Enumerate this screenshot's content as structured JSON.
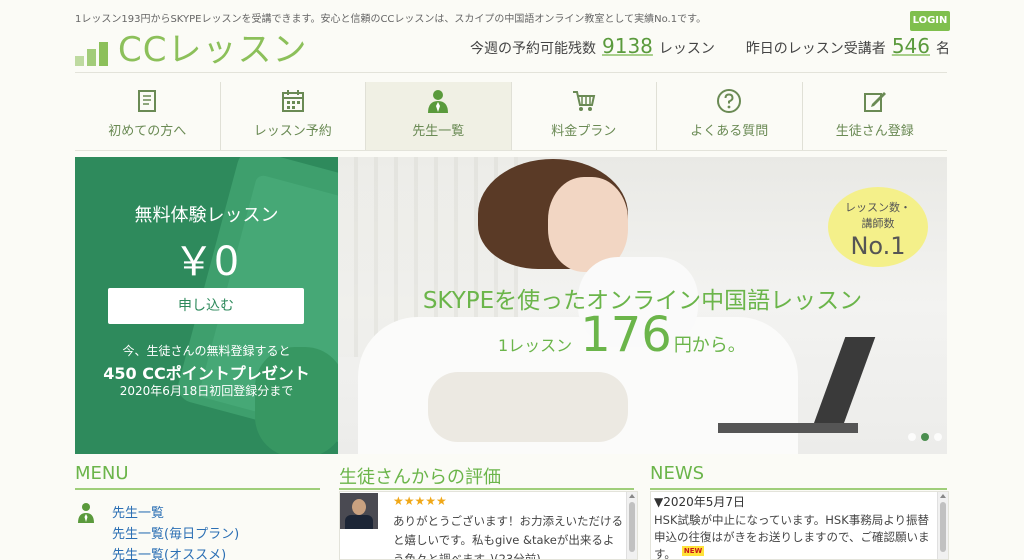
{
  "header": {
    "tagline": "1レッスン193円からSKYPEレッスンを受講できます。安心と信頼のCCレッスンは、スカイプの中国語オンライン教室として実績No.1です。",
    "login_label": "LOGIN",
    "logo_text": "CCレッスン",
    "stats": {
      "left_prefix": "今週の予約可能残数",
      "left_value": "9138",
      "left_suffix": "レッスン",
      "right_prefix": "昨日のレッスン受講者",
      "right_value": "546",
      "right_suffix": "名"
    }
  },
  "nav": {
    "items": [
      {
        "label": "初めての方へ",
        "icon": "book-icon"
      },
      {
        "label": "レッスン予約",
        "icon": "calendar-icon"
      },
      {
        "label": "先生一覧",
        "icon": "teacher-icon"
      },
      {
        "label": "料金プラン",
        "icon": "cart-icon"
      },
      {
        "label": "よくある質問",
        "icon": "question-icon"
      },
      {
        "label": "生徒さん登録",
        "icon": "edit-icon"
      }
    ]
  },
  "promo": {
    "title": "無料体験レッスン",
    "price": "￥0",
    "apply_label": "申し込む",
    "line1": "今、生徒さんの無料登録すると",
    "line2": "450 CCポイントプレゼント",
    "line3": "2020年6月18日初回登録分まで"
  },
  "slide": {
    "headline": "SKYPEを使ったオンライン中国語レッスン",
    "price_prefix": "1レッスン",
    "price_value": "176",
    "price_suffix": "円から。",
    "badge_line1": "レッスン数・",
    "badge_line2": "講師数",
    "badge_line3": "No.1",
    "dots": 3,
    "active_dot": 2
  },
  "menu": {
    "title": "MENU",
    "links": [
      "先生一覧",
      "先生一覧(毎日プラン)",
      "先生一覧(オススメ)"
    ]
  },
  "reviews": {
    "title": "生徒さんからの評価",
    "stars": "★★★★★",
    "text": "ありがとうございます！お力添えいただけると嬉しいです。私もgive &takeが出来るよう色々と調べます。)(23分前)"
  },
  "news": {
    "title": "NEWS",
    "date": "▼2020年5月7日",
    "text": "HSK試験が中止になっています。HSK事務局より振替申込の往復はがきをお送りしますので、ご確認願います。",
    "new_badge": "NEW"
  },
  "colors": {
    "brand_green": "#8cc05a",
    "promo_green": "#2e8a5c",
    "link_blue": "#2b6fb4",
    "star_orange": "#f0a818",
    "badge_yellow": "#f4f08a"
  }
}
